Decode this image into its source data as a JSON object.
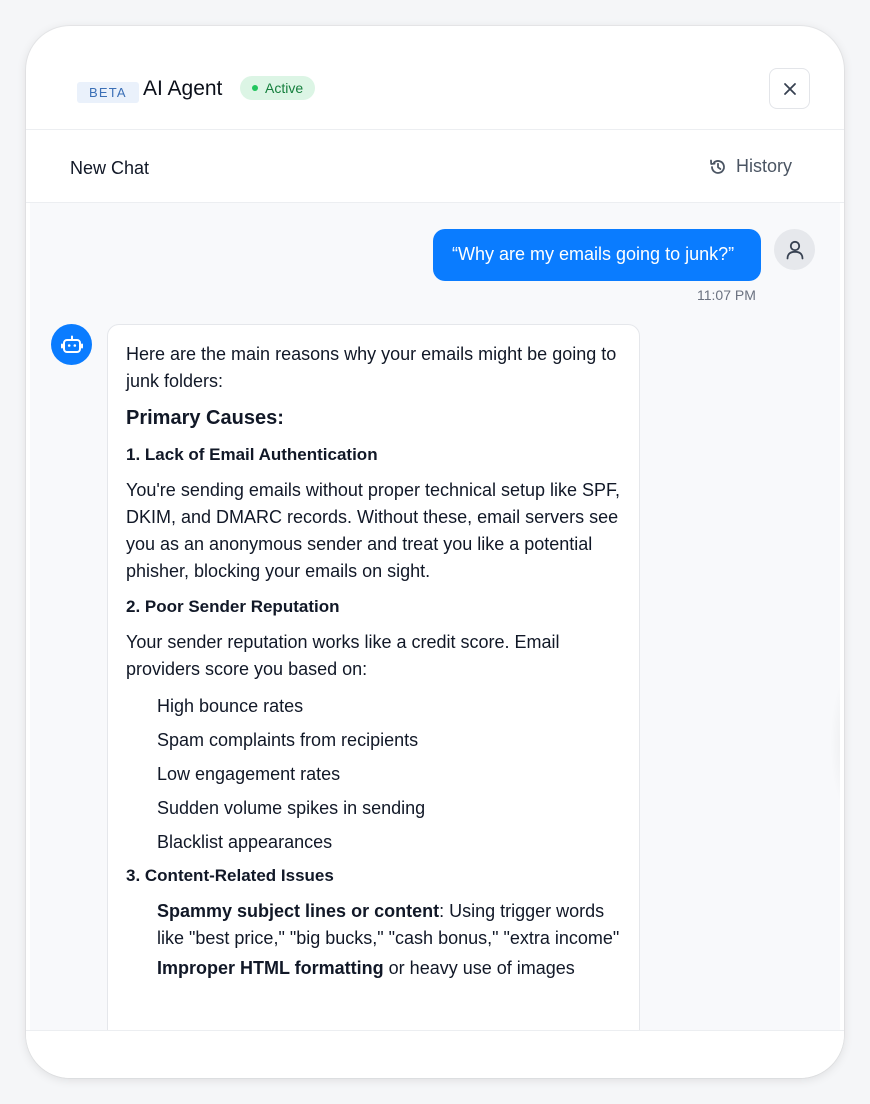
{
  "header": {
    "beta_label": "BETA",
    "title": "AI Agent",
    "status": "Active",
    "colors": {
      "accent": "#0a7cff",
      "status_bg": "#dcf5e5",
      "status_text": "#157f3d"
    }
  },
  "subbar": {
    "new_chat_label": "New Chat",
    "history_label": "History"
  },
  "conversation": {
    "user_message": "“Why are my emails going to junk?”",
    "user_timestamp": "11:07 PM",
    "bot": {
      "intro": "Here are the main reasons why your emails might be going to junk folders:",
      "heading": "Primary Causes:",
      "sections": [
        {
          "title": "1. Lack of Email Authentication",
          "body": "You're sending emails without proper technical setup like SPF, DKIM, and DMARC records. Without these, email servers see you as an anonymous sender and treat you like a potential phisher, blocking your emails on sight."
        },
        {
          "title": "2. Poor Sender Reputation",
          "body": "Your sender reputation works like a credit score. Email providers score you based on:",
          "items": [
            "High bounce rates",
            "Spam complaints from recipients",
            "Low engagement rates",
            "Sudden volume spikes in sending",
            "Blacklist appearances"
          ]
        },
        {
          "title": "3. Content-Related Issues",
          "items_rich": [
            {
              "strong": "Spammy subject lines or content",
              "rest": ": Using trigger words like \"best price,\" \"big bucks,\" \"cash bonus,\" \"extra income\""
            },
            {
              "strong": "Improper HTML formatting",
              "rest": " or heavy use of images"
            }
          ]
        }
      ]
    }
  },
  "icons": {
    "close": "close-icon",
    "history": "history-icon",
    "user_avatar": "user-icon",
    "bot_avatar": "bot-icon"
  }
}
